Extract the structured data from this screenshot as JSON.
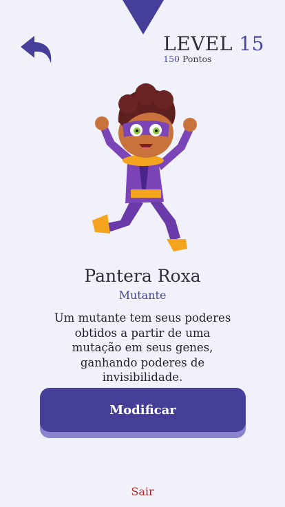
{
  "header": {
    "level_word": "LEVEL",
    "level_number": "15",
    "points_value": "150",
    "points_label": "Pontos",
    "back_icon": "undo-arrow-icon",
    "top_tab_icon": "triangle-down-icon"
  },
  "hero": {
    "name": "Pantera Roxa",
    "type": "Mutante",
    "description": "Um mutante tem seus poderes obtidos a partir de uma mutação em seus genes, ganhando poderes de invisibilidade.",
    "image": "purple-superhero-kid-illustration"
  },
  "actions": {
    "modify_label": "Modificar",
    "exit_label": "Sair"
  },
  "colors": {
    "accent": "#463f98",
    "button_shadow": "#8a84cf",
    "background": "#f1f1f9",
    "exit": "#b3262b"
  }
}
